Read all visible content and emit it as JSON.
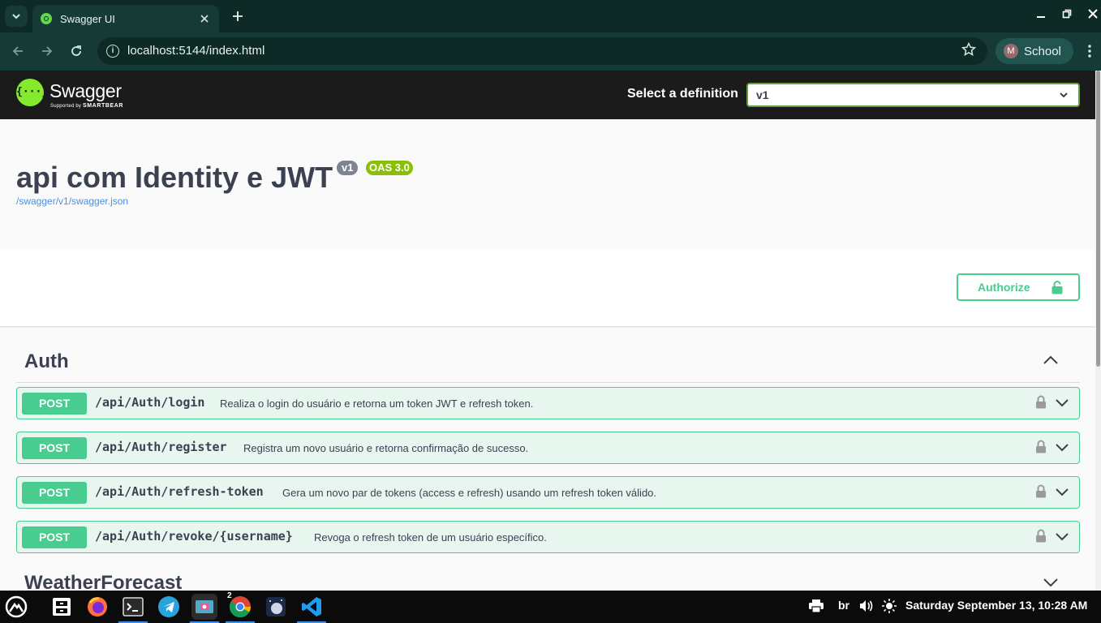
{
  "browser": {
    "tab_title": "Swagger UI",
    "url": "localhost:5144/index.html",
    "profile_initial": "M",
    "profile_name": "School"
  },
  "swagger": {
    "brand": "Swagger",
    "brand_sub_prefix": "Supported by",
    "brand_sub_company": "SMARTBEAR",
    "definition_label": "Select a definition",
    "definition_value": "v1"
  },
  "info": {
    "title": "api com Identity e JWT",
    "version_badge": "v1",
    "oas_badge": "OAS 3.0",
    "spec_url": "/swagger/v1/swagger.json"
  },
  "authorize_label": "Authorize",
  "tags": [
    {
      "name": "Auth",
      "operations": [
        {
          "method": "POST",
          "path": "/api/Auth/login",
          "summary": "Realiza o login do usuário e retorna um token JWT e refresh token."
        },
        {
          "method": "POST",
          "path": "/api/Auth/register",
          "summary": "Registra um novo usuário e retorna confirmação de sucesso."
        },
        {
          "method": "POST",
          "path": "/api/Auth/refresh-token",
          "summary": "Gera um novo par de tokens (access e refresh) usando um refresh token válido."
        },
        {
          "method": "POST",
          "path": "/api/Auth/revoke/{username}",
          "summary": "Revoga o refresh token de um usuário específico."
        }
      ]
    },
    {
      "name": "WeatherForecast"
    }
  ],
  "taskbar": {
    "chrome_badge": "2",
    "keyboard_layout": "br",
    "datetime": "Saturday September 13, 10:28 AM"
  },
  "colors": {
    "post": "#49cc90",
    "post_bg": "#e8f6f0",
    "swagger_green": "#85ea2d",
    "topbar": "#1b1b1b",
    "browser_dark": "#0d2a26",
    "browser_toolbar": "#163b36"
  }
}
